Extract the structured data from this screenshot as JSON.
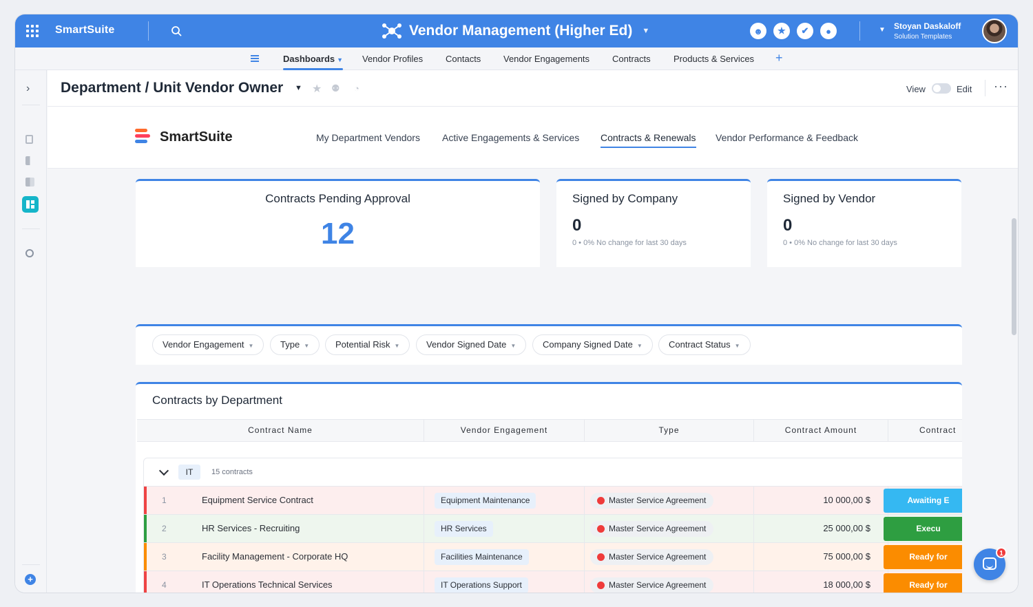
{
  "topbar": {
    "brand": "SmartSuite",
    "solution_title": "Vendor Management (Higher Ed)",
    "user_name": "Stoyan Daskaloff",
    "user_role": "Solution Templates",
    "action_icons": [
      "members-icon",
      "star-icon",
      "check-icon",
      "bell-icon"
    ]
  },
  "nav": {
    "tabs": [
      {
        "label": "Dashboards",
        "active": true
      },
      {
        "label": "Vendor Profiles"
      },
      {
        "label": "Contacts"
      },
      {
        "label": "Vendor Engagements"
      },
      {
        "label": "Contracts"
      },
      {
        "label": "Products & Services"
      }
    ],
    "add_label": "+"
  },
  "page": {
    "title": "Department / Unit Vendor Owner",
    "view_label": "View",
    "edit_label": "Edit",
    "more_label": "···"
  },
  "dashboard": {
    "logo_text": "SmartSuite",
    "tabs": [
      {
        "label": "My Department Vendors"
      },
      {
        "label": "Active Engagements & Services"
      },
      {
        "label": "Contracts & Renewals",
        "active": true
      },
      {
        "label": "Vendor Performance & Feedback"
      }
    ]
  },
  "stats": {
    "pending": {
      "title": "Contracts Pending Approval",
      "value": "12"
    },
    "company": {
      "title": "Signed by Company",
      "value": "0",
      "sub": "0 • 0% No change for last 30 days"
    },
    "vendor": {
      "title": "Signed by Vendor",
      "value": "0",
      "sub": "0 • 0% No change for last 30 days"
    }
  },
  "filters": [
    {
      "label": "Vendor Engagement"
    },
    {
      "label": "Type"
    },
    {
      "label": "Potential Risk"
    },
    {
      "label": "Vendor Signed Date"
    },
    {
      "label": "Company Signed Date"
    },
    {
      "label": "Contract Status"
    }
  ],
  "table": {
    "title": "Contracts by Department",
    "columns": [
      "Contract Name",
      "Vendor Engagement",
      "Type",
      "Contract Amount",
      "Contract"
    ],
    "group": {
      "label": "IT",
      "count": "15 contracts"
    },
    "rows": [
      {
        "idx": "1",
        "name": "Equipment Service Contract",
        "engagement": "Equipment Maintenance",
        "type": "Master Service Agreement",
        "amount": "10 000,00 $",
        "status": "Awaiting E",
        "status_color": "#35b8f2",
        "bar_color": "#ef4444",
        "row_bg": "#fdeeee"
      },
      {
        "idx": "2",
        "name": "HR Services - Recruiting",
        "engagement": "HR Services",
        "type": "Master Service Agreement",
        "amount": "25 000,00 $",
        "status": "Execu",
        "status_color": "#2e9e41",
        "bar_color": "#2e9e41",
        "row_bg": "#eef6ee"
      },
      {
        "idx": "3",
        "name": "Facility Management - Corporate HQ",
        "engagement": "Facilities Maintenance",
        "type": "Master Service Agreement",
        "amount": "75 000,00 $",
        "status": "Ready for",
        "status_color": "#fb8c00",
        "bar_color": "#fb8c00",
        "row_bg": "#fff2ea"
      },
      {
        "idx": "4",
        "name": "IT Operations Technical Services",
        "engagement": "IT Operations Support",
        "type": "Master Service Agreement",
        "amount": "18 000,00 $",
        "status": "Ready for",
        "status_color": "#fb8c00",
        "bar_color": "#ef4444",
        "row_bg": "#fdeeee"
      }
    ]
  },
  "chat": {
    "badge": "1"
  }
}
